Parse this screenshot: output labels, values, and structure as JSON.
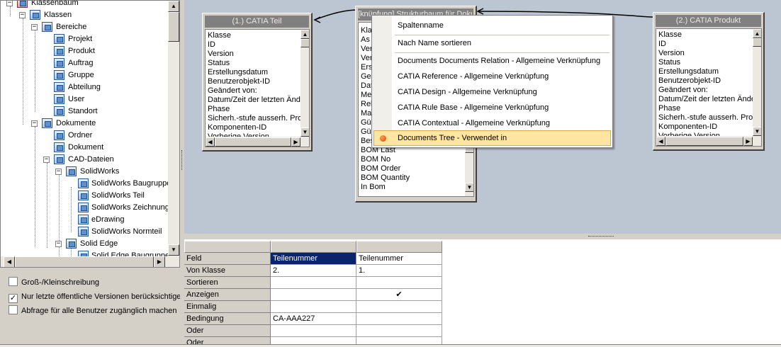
{
  "tree": {
    "items": [
      {
        "label": "Klassenbaum",
        "expander": "−"
      },
      {
        "label": "Klassen",
        "expander": "−"
      },
      {
        "label": "Bereiche",
        "expander": "−"
      },
      {
        "label": "Projekt",
        "expander": ""
      },
      {
        "label": "Produkt",
        "expander": ""
      },
      {
        "label": "Auftrag",
        "expander": ""
      },
      {
        "label": "Gruppe",
        "expander": ""
      },
      {
        "label": "Abteilung",
        "expander": ""
      },
      {
        "label": "User",
        "expander": ""
      },
      {
        "label": "Standort",
        "expander": ""
      },
      {
        "label": "Dokumente",
        "expander": "−"
      },
      {
        "label": "Ordner",
        "expander": ""
      },
      {
        "label": "Dokument",
        "expander": ""
      },
      {
        "label": "CAD-Dateien",
        "expander": "−"
      },
      {
        "label": "SolidWorks",
        "expander": "−"
      },
      {
        "label": "SolidWorks Baugruppe",
        "expander": ""
      },
      {
        "label": "SolidWorks Teil",
        "expander": ""
      },
      {
        "label": "SolidWorks Zeichnung",
        "expander": ""
      },
      {
        "label": "eDrawing",
        "expander": ""
      },
      {
        "label": "SolidWorks Normteil",
        "expander": ""
      },
      {
        "label": "Solid Edge",
        "expander": "−"
      },
      {
        "label": "Solid Edge Baugruppe",
        "expander": ""
      }
    ]
  },
  "options": {
    "case_sensitive": {
      "label": "Groß-/Kleinschreibung",
      "checked": false,
      "mark": ""
    },
    "latest_public": {
      "label": "Nur letzte öffentliche Versionen berücksichtigen",
      "checked": true,
      "mark": "✓"
    },
    "all_users": {
      "label": "Abfrage für alle Benutzer zugänglich machen",
      "checked": false,
      "mark": ""
    }
  },
  "entities": {
    "catia_teil": {
      "title": "(1.) CATIA Teil",
      "fields": [
        "Klasse",
        "ID",
        "Version",
        "Status",
        "Erstellungsdatum",
        "Benutzerobjekt-ID",
        "Geändert von:",
        "Datum/Zeit der letzten Änderung",
        "Phase",
        "Sicherh.-stufe ausserh. Proz",
        "Komponenten-ID",
        "Vorherige Version"
      ]
    },
    "struktur": {
      "title": "[knüpfung] Strukturbaum für Dokum",
      "fields": [
        "Kla",
        "As",
        "Ver",
        "Ver",
        "Ers",
        "Ge",
        "Dat",
        "Me",
        "Rel",
        "Ma",
        "Gül",
        "Gül",
        "Bes",
        "BOM Last",
        "BOM No",
        "BOM Order",
        "BOM Quantity",
        "In Bom"
      ]
    },
    "catia_produkt": {
      "title": "(2.) CATIA Produkt",
      "fields": [
        "Klasse",
        "ID",
        "Version",
        "Status",
        "Erstellungsdatum",
        "Benutzerobjekt-ID",
        "Geändert von:",
        "Datum/Zeit der letzten Änderung",
        "Phase",
        "Sicherh.-stufe ausserh. Proz",
        "Komponenten-ID",
        "Vorherige Version"
      ]
    }
  },
  "context_menu": {
    "items": [
      {
        "label": "Spaltenname"
      },
      {
        "label": "Nach Name sortieren"
      },
      {
        "label": "Documents Documents Relation - Allgemeine Verknüpfung"
      },
      {
        "label": "CATIA Reference - Allgemeine Verknüpfung"
      },
      {
        "label": "CATIA Design - Allgemeine Verknüpfung"
      },
      {
        "label": "CATIA Rule Base - Allgemeine Verknüpfung"
      },
      {
        "label": "CATIA Contextual - Allgemeine Verknüpfung"
      },
      {
        "label": "Documents Tree - Verwendet in",
        "selected": true
      }
    ]
  },
  "grid": {
    "row_labels": [
      "Feld",
      "Von Klasse",
      "Sortieren",
      "Anzeigen",
      "Einmalig",
      "Bedingung",
      "Oder",
      "Oder"
    ],
    "columns": [
      {
        "Feld": "Teilenummer",
        "Von Klasse": "2.",
        "Sortieren": "",
        "Anzeigen": "",
        "Einmalig": "",
        "Bedingung": "CA-AAA227",
        "Oder": "",
        "Oder2": ""
      },
      {
        "Feld": "Teilenummer",
        "Von Klasse": "1.",
        "Sortieren": "",
        "Anzeigen": "✔",
        "Einmalig": "",
        "Bedingung": "",
        "Oder": "",
        "Oder2": ""
      }
    ]
  }
}
